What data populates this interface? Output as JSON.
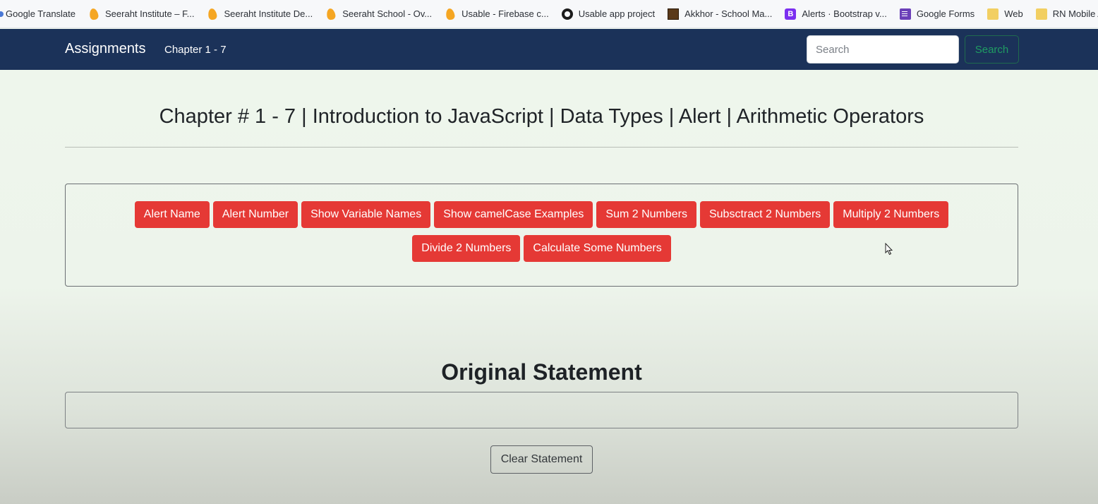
{
  "bookmarks": [
    {
      "label": "Google Translate",
      "icon": "edge-icon"
    },
    {
      "label": "Seeraht Institute – F...",
      "icon": "firebase-icon"
    },
    {
      "label": "Seeraht Institute De...",
      "icon": "firebase-icon"
    },
    {
      "label": "Seeraht School - Ov...",
      "icon": "firebase-icon"
    },
    {
      "label": "Usable - Firebase c...",
      "icon": "firebase-icon"
    },
    {
      "label": "Usable app project",
      "icon": "github-icon"
    },
    {
      "label": "Akkhor - School Ma...",
      "icon": "akkhor-icon"
    },
    {
      "label": "Alerts · Bootstrap v...",
      "icon": "bootstrap-icon"
    },
    {
      "label": "Google Forms",
      "icon": "google-forms-icon"
    },
    {
      "label": "Web",
      "icon": "folder-icon"
    },
    {
      "label": "RN Mobile App",
      "icon": "folder-icon"
    }
  ],
  "bookmarks_more": "»",
  "navbar": {
    "brand": "Assignments",
    "link": "Chapter 1 - 7",
    "search_placeholder": "Search",
    "search_button": "Search"
  },
  "main": {
    "heading": "Chapter # 1 - 7 | Introduction to JavaScript | Data Types | Alert | Arithmetic Operators",
    "buttons_row1": [
      "Alert Name",
      "Alert Number",
      "Show Variable Names",
      "Show camelCase Examples",
      "Sum 2 Numbers",
      "Subsctract 2 Numbers",
      "Multiply 2 Numbers"
    ],
    "buttons_row2": [
      "Divide 2 Numbers",
      "Calculate Some Numbers"
    ],
    "section_title": "Original Statement",
    "clear_button": "Clear Statement"
  },
  "colors": {
    "navbar": "#1b3259",
    "action_button": "#e53935",
    "search_button_text": "#1f9d63"
  }
}
